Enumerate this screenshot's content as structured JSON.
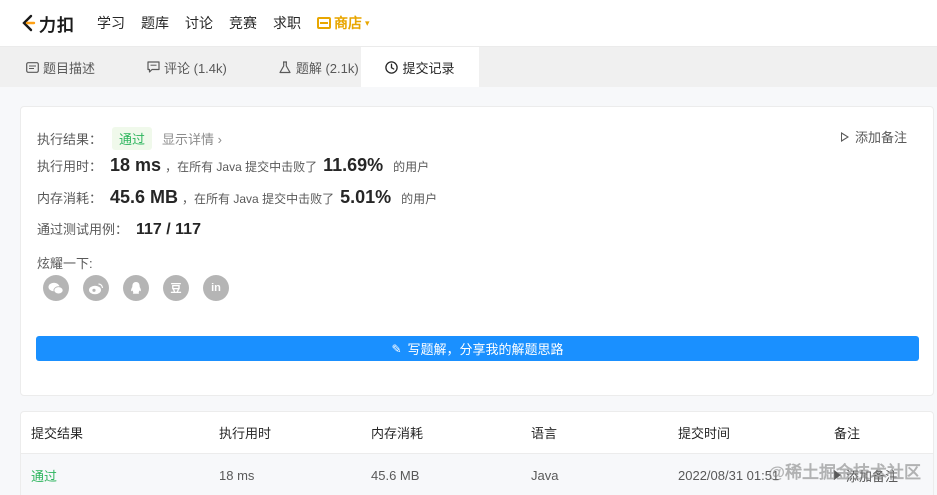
{
  "brand": {
    "name": "力扣"
  },
  "nav": {
    "items": [
      "学习",
      "题库",
      "讨论",
      "竞赛",
      "求职"
    ],
    "store": "商店"
  },
  "tabs": [
    {
      "label": "题目描述",
      "icon": "document-icon"
    },
    {
      "label": "评论 (1.4k)",
      "icon": "comment-icon"
    },
    {
      "label": "题解 (2.1k)",
      "icon": "flask-icon"
    },
    {
      "label": "提交记录",
      "icon": "clock-icon",
      "active": true
    }
  ],
  "result": {
    "status_label": "执行结果：",
    "status": "通过",
    "show_details": "显示详情 ›",
    "add_note": "添加备注",
    "runtime_label": "执行用时：",
    "runtime": "18 ms",
    "runtime_text": "，在所有 Java 提交中击败了",
    "runtime_pct": "11.69%",
    "users_suffix": "的用户",
    "memory_label": "内存消耗：",
    "memory": "45.6 MB",
    "memory_text": "，在所有 Java 提交中击败了",
    "memory_pct": "5.01%",
    "testcases_label": "通过测试用例：",
    "testcases": "117 / 117",
    "share_label": "炫耀一下:",
    "share_icons": [
      "wechat-icon",
      "weibo-icon",
      "qq-icon",
      "douban-icon",
      "linkedin-icon"
    ],
    "share_glyphs": {
      "douban": "豆",
      "linkedin": "in"
    },
    "write_button": "写题解，分享我的解题思路"
  },
  "table": {
    "headers": [
      "提交结果",
      "执行用时",
      "内存消耗",
      "语言",
      "提交时间",
      "备注"
    ],
    "rows": [
      {
        "result": "通过",
        "runtime": "18 ms",
        "memory": "45.6 MB",
        "language": "Java",
        "time": "2022/08/31 01:51",
        "note": "添加备注"
      }
    ]
  },
  "watermark": "@稀土掘金技术社区",
  "colors": {
    "accent": "#1a90ff",
    "success": "#2db55d",
    "store": "#e8a600"
  }
}
